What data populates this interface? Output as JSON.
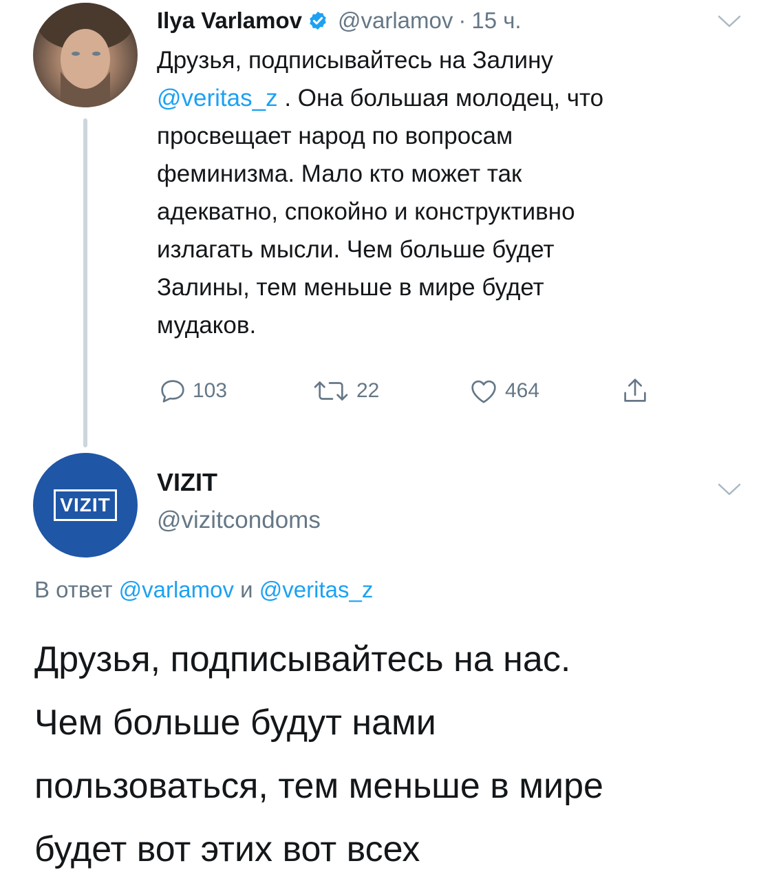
{
  "tweet1": {
    "author_name": "Ilya Varlamov",
    "handle": "@varlamov",
    "separator": "·",
    "time": "15 ч.",
    "text_lines": [
      "Друзья, подписывайтесь на Залину",
      "",
      "просвещает народ по вопросам",
      "феминизма. Мало кто может так",
      "адекватно, спокойно и конструктивно",
      "излагать мысли. Чем больше будет",
      "Залины, тем меньше в мире будет",
      "мудаков."
    ],
    "line2_mention": "@veritas_z",
    "line2_rest": " . Она большая молодец, что",
    "reply_count": "103",
    "retweet_count": "22",
    "like_count": "464"
  },
  "tweet2": {
    "author_name": "VIZIT",
    "handle": "@vizitcondoms",
    "avatar_logo": "VIZIT",
    "reply_prefix": "В ответ ",
    "reply_mention1": "@varlamov",
    "reply_and": " и ",
    "reply_mention2": "@veritas_z",
    "text_lines": [
      "Друзья, подписывайтесь на нас.",
      "Чем больше будут нами",
      "пользоваться, тем меньше в мире",
      "будет вот этих вот всех"
    ]
  },
  "colors": {
    "link": "#1da1f2",
    "secondary_text": "#657786",
    "primary_text": "#14171a",
    "vizit_brand": "#1f56a6",
    "thread_line": "#ccd6dd"
  },
  "icons": [
    "verified-badge-icon",
    "chevron-down-icon",
    "reply-icon",
    "retweet-icon",
    "like-icon",
    "share-icon"
  ]
}
